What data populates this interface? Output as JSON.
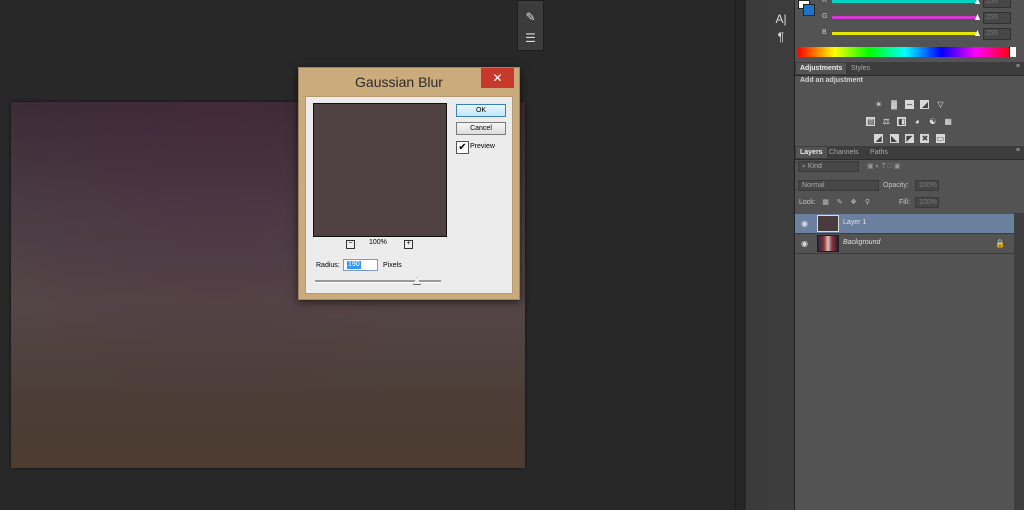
{
  "dialog": {
    "title": "Gaussian Blur",
    "close_icon": "close-icon",
    "ok_label": "OK",
    "cancel_label": "Cancel",
    "preview_label": "Preview",
    "preview_checked": true,
    "zoom_level": "100%",
    "zoom_out_icon": "zoom-out-icon",
    "zoom_in_icon": "zoom-in-icon",
    "radius_label": "Radius:",
    "radius_value": "190",
    "radius_unit": "Pixels"
  },
  "color_panel": {
    "channels": [
      {
        "label": "R",
        "value": "255",
        "color": "#00d3c4"
      },
      {
        "label": "G",
        "value": "255",
        "color": "#d03ad0"
      },
      {
        "label": "B",
        "value": "255",
        "color": "#e6e600"
      }
    ],
    "foreground_color": "#ffffff",
    "background_color": "#1f74c9"
  },
  "adjustments_panel": {
    "tabs": [
      "Adjustments",
      "Styles"
    ],
    "active_tab": "Adjustments",
    "heading": "Add an adjustment"
  },
  "layers_panel": {
    "tabs": [
      "Layers",
      "Channels",
      "Paths"
    ],
    "active_tab": "Layers",
    "filter_kind": "Kind",
    "blend_mode": "Normal",
    "opacity_label": "Opacity:",
    "opacity_value": "100%",
    "lock_label": "Lock:",
    "fill_label": "Fill:",
    "fill_value": "100%",
    "layers": [
      {
        "name": "Layer 1",
        "selected": true,
        "visible": true,
        "locked": false
      },
      {
        "name": "Background",
        "selected": false,
        "visible": true,
        "locked": true
      }
    ]
  },
  "icons": {
    "eye": "eye-icon",
    "lock": "lock-icon",
    "panel_menu": "panel-menu-icon",
    "character": "character-icon",
    "paragraph": "paragraph-icon",
    "brush": "brush-icon",
    "properties": "properties-icon"
  },
  "accent_color": "#c7392b",
  "selection_color": "#6b7f9f"
}
